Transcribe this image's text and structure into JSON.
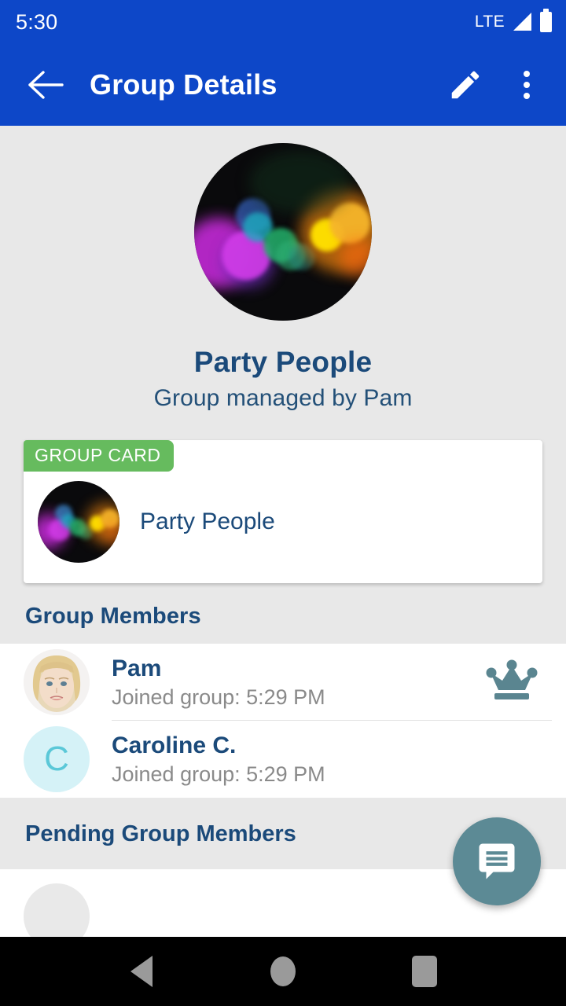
{
  "status_bar": {
    "clock": "5:30",
    "network": "LTE",
    "signal_icon": "signal-triangle-icon",
    "battery_icon": "battery-full-icon"
  },
  "app_bar": {
    "back_icon": "arrow-left-icon",
    "title": "Group Details",
    "edit_icon": "pencil-icon",
    "overflow_icon": "more-vertical-icon"
  },
  "hero": {
    "avatar_icon": "group-photo-bokeh-lights",
    "group_name": "Party People",
    "managed_by": "Group managed by Pam"
  },
  "group_card": {
    "badge": "GROUP CARD",
    "title": "Party People",
    "avatar_icon": "group-photo-bokeh-lights"
  },
  "members_section": {
    "heading": "Group Members",
    "members": [
      {
        "name": "Pam",
        "joined": "Joined group: 5:29 PM",
        "avatar_type": "photo",
        "avatar_initial": "",
        "is_admin": true,
        "admin_icon": "crown-icon"
      },
      {
        "name": "Caroline C.",
        "joined": "Joined group: 5:29 PM",
        "avatar_type": "initial",
        "avatar_initial": "C",
        "is_admin": false,
        "admin_icon": ""
      }
    ]
  },
  "pending_section": {
    "heading": "Pending Group Members"
  },
  "fab": {
    "icon": "chat-bubble-icon",
    "color": "#5c8a95"
  },
  "nav_bar": {
    "back_icon": "nav-back-triangle-icon",
    "home_icon": "nav-home-circle-icon",
    "recents_icon": "nav-recents-square-icon"
  },
  "colors": {
    "app_bar": "#0d47c8",
    "page_bg": "#e8e8e8",
    "accent_text": "#1b4a7a",
    "badge_green": "#66bb5e",
    "fab_teal": "#5c8a95",
    "initial_avatar_bg": "#d5f2f7",
    "initial_avatar_fg": "#5bc8d8"
  }
}
